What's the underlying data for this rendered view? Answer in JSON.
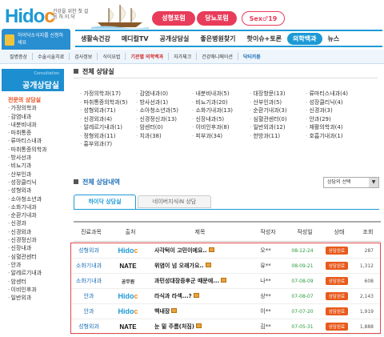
{
  "brand": {
    "logo_main": "Hido",
    "logo_accent": "c",
    "tagline": "건강을 위한 첫 걸음 하.이.닥"
  },
  "top_tabs": [
    "성형포럼",
    "당뇨포럼",
    "Sex♂19"
  ],
  "promo": {
    "text": "하이닥소식지를 신청하세요"
  },
  "main_nav": [
    {
      "label": "생활속건강",
      "active": false
    },
    {
      "label": "메디컬TV",
      "active": false
    },
    {
      "label": "공개상담실",
      "active": false
    },
    {
      "label": "좋은병원찾기",
      "active": false
    },
    {
      "label": "핫이슈+토론",
      "active": false
    },
    {
      "label": "의학백과",
      "active": true
    },
    {
      "label": "뉴스",
      "active": false
    }
  ],
  "sub_nav": [
    {
      "label": "질병증상",
      "style": "normal"
    },
    {
      "label": "수술시술치료",
      "style": "normal"
    },
    {
      "label": "검사정보",
      "style": "normal"
    },
    {
      "label": "식이요법",
      "style": "normal"
    },
    {
      "label": "기관별 의학백과",
      "style": "hot"
    },
    {
      "label": "자가체크",
      "style": "normal"
    },
    {
      "label": "건강애니메이션",
      "style": "normal"
    },
    {
      "label": "닥터카툰",
      "style": "active"
    }
  ],
  "sidebar": {
    "header_small": "Consultation",
    "header_title": "공개상담실",
    "items": [
      {
        "label": "전문의 상담실",
        "current": true
      },
      {
        "label": "가정의학과"
      },
      {
        "label": "감염내과"
      },
      {
        "label": "내분비내과"
      },
      {
        "label": "마취통증"
      },
      {
        "label": "류마티스내과"
      },
      {
        "label": "마취통증의학과"
      },
      {
        "label": "방사선과"
      },
      {
        "label": "비뇨기과"
      },
      {
        "label": "산부인과"
      },
      {
        "label": "성장클리닉"
      },
      {
        "label": "성형외과"
      },
      {
        "label": "소아청소년과"
      },
      {
        "label": "소화기내과"
      },
      {
        "label": "순환기내과"
      },
      {
        "label": "신경과"
      },
      {
        "label": "신경외과"
      },
      {
        "label": "신경정신과"
      },
      {
        "label": "신장내과"
      },
      {
        "label": "심혈관센터"
      },
      {
        "label": "안과"
      },
      {
        "label": "알레르기내과"
      },
      {
        "label": "암센터"
      },
      {
        "label": "이비인후과"
      },
      {
        "label": "일반외과"
      }
    ]
  },
  "section_all": {
    "title": "전체 상담실"
  },
  "categories": [
    "가정의학과(17)",
    "감염내과(0)",
    "내분비내과(5)",
    "대장항문(13)",
    "류마티스내과(4)",
    "마취통증의학과(5)",
    "방사선과(1)",
    "비뇨기과(20)",
    "산부인과(5)",
    "성장클리닉(4)",
    "성형외과(71)",
    "소아청소년과(5)",
    "소화기내과(13)",
    "순환기내과(3)",
    "신경과(3)",
    "신경외과(4)",
    "신경정신과(13)",
    "신장내과(5)",
    "심혈관센터(0)",
    "안과(29)",
    "알레르기내과(1)",
    "암센터(0)",
    "이비인후과(8)",
    "일반외과(12)",
    "재활의학과(4)",
    "정형외과(11)",
    "치과(38)",
    "피부과(34)",
    "한방과(11)",
    "호흡기내과(1)",
    "흉부외과(7)"
  ],
  "section_list": {
    "title": "전체 상담내역"
  },
  "sort_select": {
    "value": "상담의 선택"
  },
  "list_tabs": [
    "하이닥 상담실",
    "네이버지식iN 상담"
  ],
  "table": {
    "headers": [
      "진료과목",
      "출처",
      "제목",
      "작성자",
      "작성일",
      "상태",
      "조회"
    ],
    "rows": [
      {
        "dept": "성형외과",
        "source": "Hidoc",
        "title": "사각턱이 고민이에요..",
        "author": "오**",
        "date": "08-12-24",
        "status": "상담완료",
        "views": "287"
      },
      {
        "dept": "소화기내과",
        "source": "NATE",
        "title": "위염이 넘 오래가요..",
        "author": "유**",
        "date": "08-09-21",
        "status": "상담완료",
        "views": "1,312"
      },
      {
        "dept": "소화기내과",
        "source": "공무원",
        "title": "과민성대장증후군 때문에...",
        "author": "나**",
        "date": "07-08-09",
        "status": "상담완료",
        "views": "608"
      },
      {
        "dept": "안과",
        "source": "Hidoc",
        "title": "라식과 라섹...?",
        "author": "상**",
        "date": "07-08-07",
        "status": "상담완료",
        "views": "2,143"
      },
      {
        "dept": "안과",
        "source": "Hidoc",
        "title": "백내장",
        "author": "이**",
        "date": "07-07-20",
        "status": "상담완료",
        "views": "1,919"
      },
      {
        "dept": "성형외과",
        "source": "NATE",
        "title": "눈 밑 주름(처짐)",
        "author": "김**",
        "date": "07-05-31",
        "status": "상담완료",
        "views": "1,888"
      }
    ]
  }
}
